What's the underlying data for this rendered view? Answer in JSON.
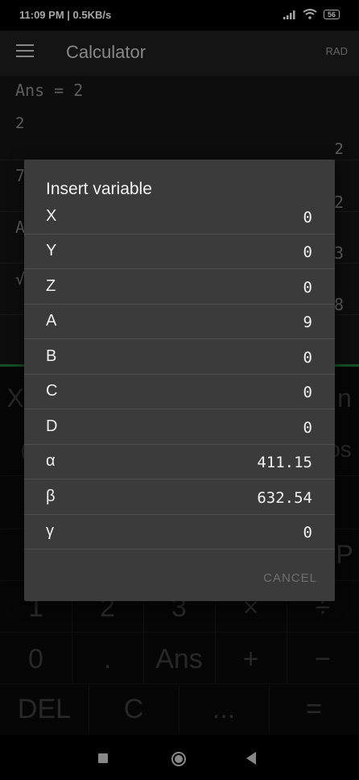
{
  "status_bar": {
    "time_info": "11:09 PM | 0.5KB/s",
    "battery": "56"
  },
  "app_bar": {
    "title": "Calculator",
    "angle_mode": "RAD"
  },
  "history": {
    "lines": [
      {
        "expr": "Ans = 2",
        "result": "2"
      },
      {
        "expr": "7",
        "result": "2"
      },
      {
        "expr": "A",
        "result": "3"
      },
      {
        "expr": "√",
        "result": "8"
      }
    ],
    "partial_result_top": "2"
  },
  "keypad": {
    "row_visible_left": [
      "X",
      "("
    ],
    "row_visible_right": [
      "n",
      "os",
      "P"
    ],
    "row_digits": [
      "1",
      "2",
      "3",
      "×",
      "÷"
    ],
    "row_zero": [
      "0",
      ".",
      "Ans",
      "+",
      "−"
    ],
    "row_bottom": [
      "DEL",
      "C",
      "...",
      "="
    ]
  },
  "dialog": {
    "title": "Insert variable",
    "variables": [
      {
        "name": "X",
        "value": "0"
      },
      {
        "name": "Y",
        "value": "0"
      },
      {
        "name": "Z",
        "value": "0"
      },
      {
        "name": "A",
        "value": "9"
      },
      {
        "name": "B",
        "value": "0"
      },
      {
        "name": "C",
        "value": "0"
      },
      {
        "name": "D",
        "value": "0"
      },
      {
        "name": "α",
        "value": "411.15"
      },
      {
        "name": "β",
        "value": "632.54"
      },
      {
        "name": "γ",
        "value": "0"
      }
    ],
    "cancel_label": "CANCEL"
  }
}
